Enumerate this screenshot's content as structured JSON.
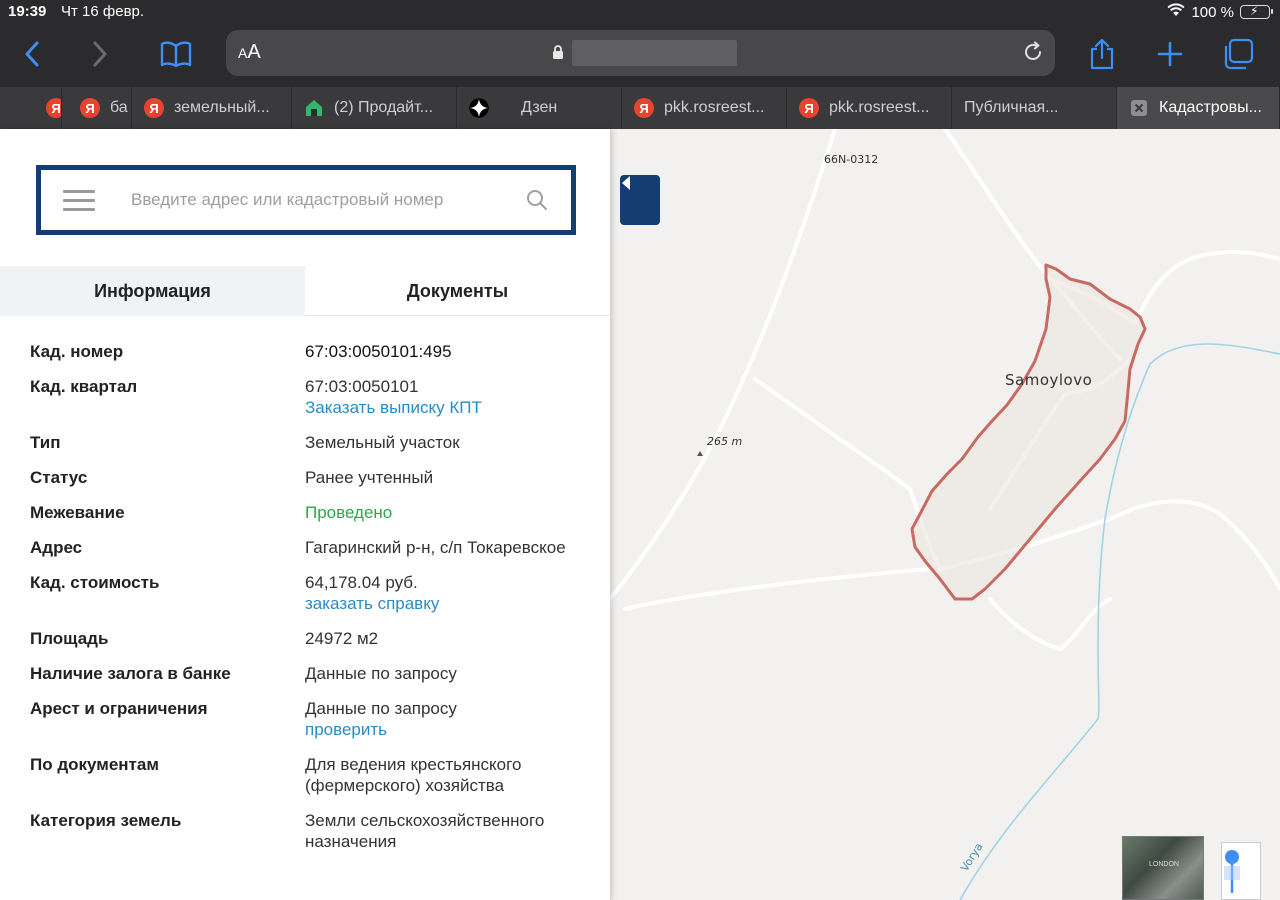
{
  "status_bar": {
    "time": "19:39",
    "date": "Чт 16 февр.",
    "battery": "100 %"
  },
  "browser": {
    "text_size_label": "AA",
    "tabs": [
      {
        "label": "",
        "icon": "yandex-icon"
      },
      {
        "label": "ба",
        "icon": "yandex-icon"
      },
      {
        "label": "земельный...",
        "icon": "yandex-icon"
      },
      {
        "label": "(2) Продайт...",
        "icon": "house-icon"
      },
      {
        "label": "Дзен",
        "icon": "zen-icon"
      },
      {
        "label": "pkk.rosreest...",
        "icon": "yandex-icon"
      },
      {
        "label": "pkk.rosreest...",
        "icon": "yandex-icon"
      },
      {
        "label": "Публичная...",
        "icon": "maps-icon"
      },
      {
        "label": "Кадастровы...",
        "icon": "close-icon",
        "active": true
      }
    ]
  },
  "search": {
    "placeholder": "Введите адрес или кадастровый номер"
  },
  "panel_tabs": {
    "info": "Информация",
    "docs": "Документы"
  },
  "details": [
    {
      "key": "Кад. номер",
      "value": "67:03:0050101:495"
    },
    {
      "key": "Кад. квартал",
      "value": "67:03:0050101",
      "link": "Заказать выписку КПТ"
    },
    {
      "key": "Тип",
      "value": "Земельный участок"
    },
    {
      "key": "Статус",
      "value": "Ранее учтенный"
    },
    {
      "key": "Межевание",
      "value": "Проведено"
    },
    {
      "key": "Адрес",
      "value": "Гагаринский р-н, с/п Токаревское"
    },
    {
      "key": "Кад. стоимость",
      "value": "64,178.04 руб.",
      "link": "заказать справку"
    },
    {
      "key": "Площадь",
      "value": "24972 м2"
    },
    {
      "key": "Наличие залога в банке",
      "value": "Данные по запросу"
    },
    {
      "key": "Арест и ограничения",
      "value": "Данные по запросу",
      "link": "проверить"
    },
    {
      "key": "По документам",
      "value": "Для ведения крестьянского (фермерского) хозяйства"
    },
    {
      "key": "Категория земель",
      "value": "Земли сельскохозяйственного назначения"
    }
  ],
  "map": {
    "road_label": "66N-0312",
    "village_label": "Samoylovo",
    "elevation_label": "265 m",
    "river_label": "Vorya",
    "thumb_label": "LONDON",
    "colors": {
      "parcel": "#c96a62",
      "river": "#9fd3e6",
      "brand": "#143d74",
      "link": "#2b8bc4",
      "green": "#2aa84a"
    }
  }
}
